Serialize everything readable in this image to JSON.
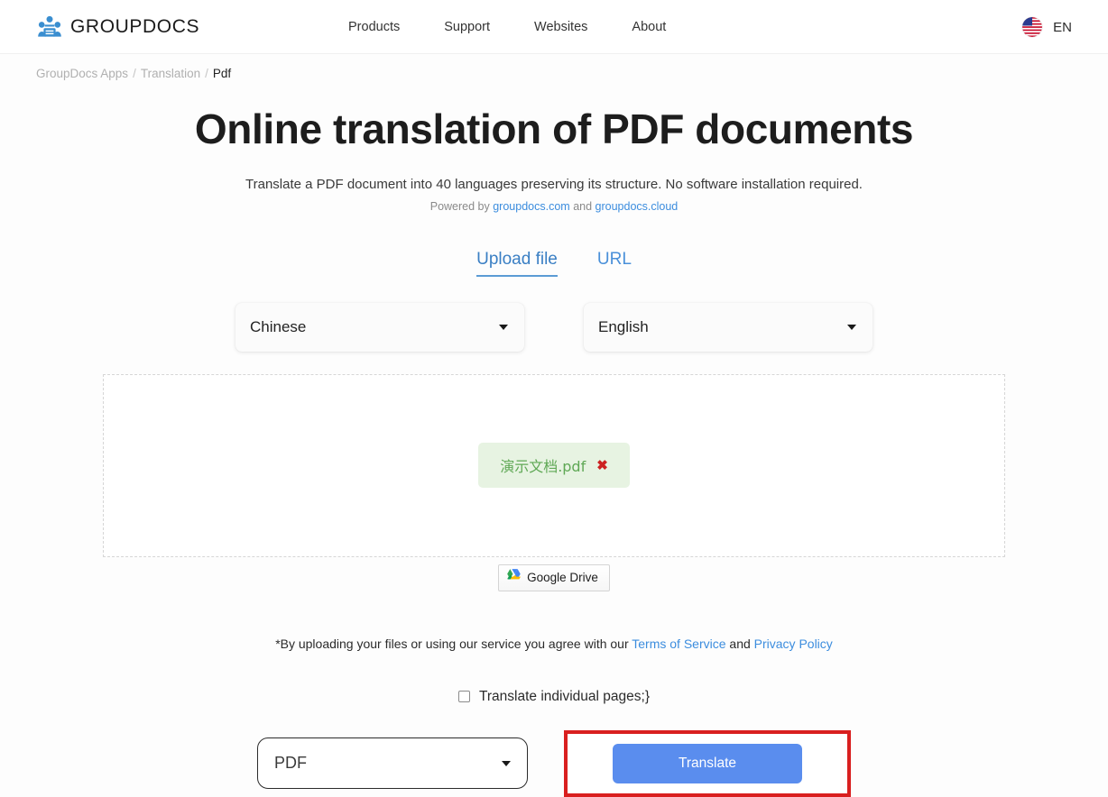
{
  "header": {
    "brand_name": "GROUPDOCS",
    "brand_icon": "group-people-icon",
    "nav": [
      {
        "label": "Products"
      },
      {
        "label": "Support"
      },
      {
        "label": "Websites"
      },
      {
        "label": "About"
      }
    ],
    "language": {
      "code": "EN",
      "flag_icon": "us-flag-icon"
    }
  },
  "breadcrumb": {
    "items": [
      {
        "label": "GroupDocs Apps",
        "current": false
      },
      {
        "label": "Translation",
        "current": false
      },
      {
        "label": "Pdf",
        "current": true
      }
    ],
    "separator": "/"
  },
  "hero": {
    "title": "Online translation of PDF documents",
    "subtitle": "Translate a PDF document into 40 languages preserving its structure. No software installation required.",
    "powered_prefix": "Powered by",
    "powered_link_1": "groupdocs.com",
    "powered_conjunction": "and",
    "powered_link_2": "groupdocs.cloud"
  },
  "tabs": [
    {
      "label": "Upload file",
      "active": true
    },
    {
      "label": "URL",
      "active": false
    }
  ],
  "language_selects": {
    "source": {
      "value": "Chinese",
      "caret_icon": "chevron-down-icon"
    },
    "target": {
      "value": "English",
      "caret_icon": "chevron-down-icon"
    }
  },
  "dropzone": {
    "file": {
      "name": "演示文档.pdf",
      "remove_icon": "✖"
    }
  },
  "google_drive": {
    "label": "Google Drive",
    "icon": "google-drive-icon"
  },
  "terms": {
    "text_prefix": "*By uploading your files or using our service you agree with our",
    "link_terms": "Terms of Service",
    "conjunction": "and",
    "link_privacy": "Privacy Policy"
  },
  "options": {
    "individual_pages_label": "Translate individual pages;}",
    "individual_pages_checked": false
  },
  "bottom": {
    "format": {
      "value": "PDF",
      "caret_icon": "chevron-down-icon"
    },
    "translate_label": "Translate",
    "highlight_color": "#d91f1f",
    "button_color": "#5a8dee"
  }
}
